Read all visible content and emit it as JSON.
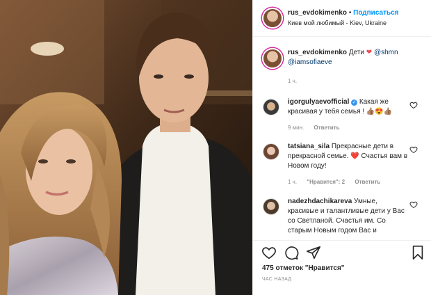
{
  "post": {
    "author": "rus_evdokimenko",
    "separator": "•",
    "follow_label": "Подписаться",
    "location": "Киев мой любимый - Kiev, Ukraine"
  },
  "caption": {
    "author": "rus_evdokimenko",
    "text": "Дети",
    "mention1": "@shmn",
    "mention2": "@iamsofiaeve",
    "time": "1 ч."
  },
  "comments": [
    {
      "author": "igorgulyaevofficial",
      "verified": true,
      "text": "Какая же красивая у тебя семья !",
      "emoji": "👍🏽😍👍🏽",
      "time": "9 мин.",
      "reply_label": "Ответить"
    },
    {
      "author": "tatsiana_sila",
      "text_a": "Прекрасные дети в прекрасной семье.",
      "emoji": "❤️",
      "text_b": "Счастья вам в Новом году!",
      "time": "1 ч.",
      "likes_label": "\"Нравится\": 2",
      "reply_label": "Ответить"
    },
    {
      "author": "nadezhdachikareva",
      "text": "Умные, красивые и талантливые дети у Вас со Светланой. Счастья им. Со старым Новым годом Вас и"
    }
  ],
  "actions": {
    "likes_text": "475 отметок \"Нравится\"",
    "timestamp": "ЧАС НАЗАД"
  },
  "icons": {
    "like": "heart-icon",
    "comment": "comment-icon",
    "share": "share-icon",
    "save": "bookmark-icon",
    "comment_like": "small-heart-icon"
  },
  "colors": {
    "link_blue": "#0095f6",
    "text": "#262626",
    "muted": "#8e8e8e",
    "heart_red": "#ed4956",
    "mention": "#00376b"
  }
}
